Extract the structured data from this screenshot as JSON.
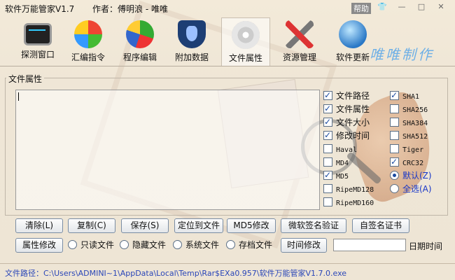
{
  "window": {
    "title": "软件万能管家V1.7",
    "author": "作者：傅明浪 - 唯唯",
    "help_label": "帮助",
    "controls": [
      "shirt-icon",
      "minimize-icon",
      "maximize-icon",
      "close-icon"
    ]
  },
  "toolbar": {
    "items": [
      {
        "label": "探测窗口",
        "icon": "monitor-icon"
      },
      {
        "label": "汇编指令",
        "icon": "xp-logo-icon"
      },
      {
        "label": "程序编辑",
        "icon": "pie-chart-icon"
      },
      {
        "label": "附加数据",
        "icon": "shield-icon"
      },
      {
        "label": "文件属性",
        "icon": "disc-icon"
      },
      {
        "label": "资源管理",
        "icon": "tools-icon"
      },
      {
        "label": "软件更新",
        "icon": "globe-icon"
      }
    ],
    "active": "文件属性",
    "watermark": "唯唯制作"
  },
  "panel": {
    "group_title": "文件属性",
    "output_text": ""
  },
  "options_left": [
    {
      "label": "文件路径",
      "checked": true
    },
    {
      "label": "文件属性",
      "checked": true
    },
    {
      "label": "文件大小",
      "checked": true
    },
    {
      "label": "修改时间",
      "checked": true
    },
    {
      "label": "Haval",
      "checked": false
    },
    {
      "label": "MD4",
      "checked": false
    },
    {
      "label": "MD5",
      "checked": true
    },
    {
      "label": "RipeMD128",
      "checked": false
    },
    {
      "label": "RipeMD160",
      "checked": false
    }
  ],
  "options_right": [
    {
      "label": "SHA1",
      "checked": true
    },
    {
      "label": "SHA256",
      "checked": false
    },
    {
      "label": "SHA384",
      "checked": false
    },
    {
      "label": "SHA512",
      "checked": false
    },
    {
      "label": "Tiger",
      "checked": false
    },
    {
      "label": "CRC32",
      "checked": true
    }
  ],
  "selection_radios": [
    {
      "label": "默认(Z)",
      "selected": true
    },
    {
      "label": "全选(A)",
      "selected": false
    }
  ],
  "buttons_row1": [
    "清除(L)",
    "复制(C)",
    "保存(S)",
    "定位到文件",
    "MD5修改",
    "微软签名验证",
    "自签名证书"
  ],
  "buttons_row2": {
    "attr_modify": "属性修改",
    "attr_radios": [
      {
        "label": "只读文件",
        "selected": false
      },
      {
        "label": "隐藏文件",
        "selected": false
      },
      {
        "label": "系统文件",
        "selected": false
      },
      {
        "label": "存档文件",
        "selected": false
      }
    ],
    "time_modify": "时间修改",
    "date_value": "",
    "date_label": "日期时间"
  },
  "status": {
    "text": "文件路径：C:\\Users\\ADMINI~1\\AppData\\Local\\Temp\\Rar$EXa0.957\\软件万能管家V1.7.0.exe"
  },
  "colors": {
    "accent_blue": "#1736c8",
    "background": "#efe6d6",
    "watermark": "#6fb0e6"
  }
}
